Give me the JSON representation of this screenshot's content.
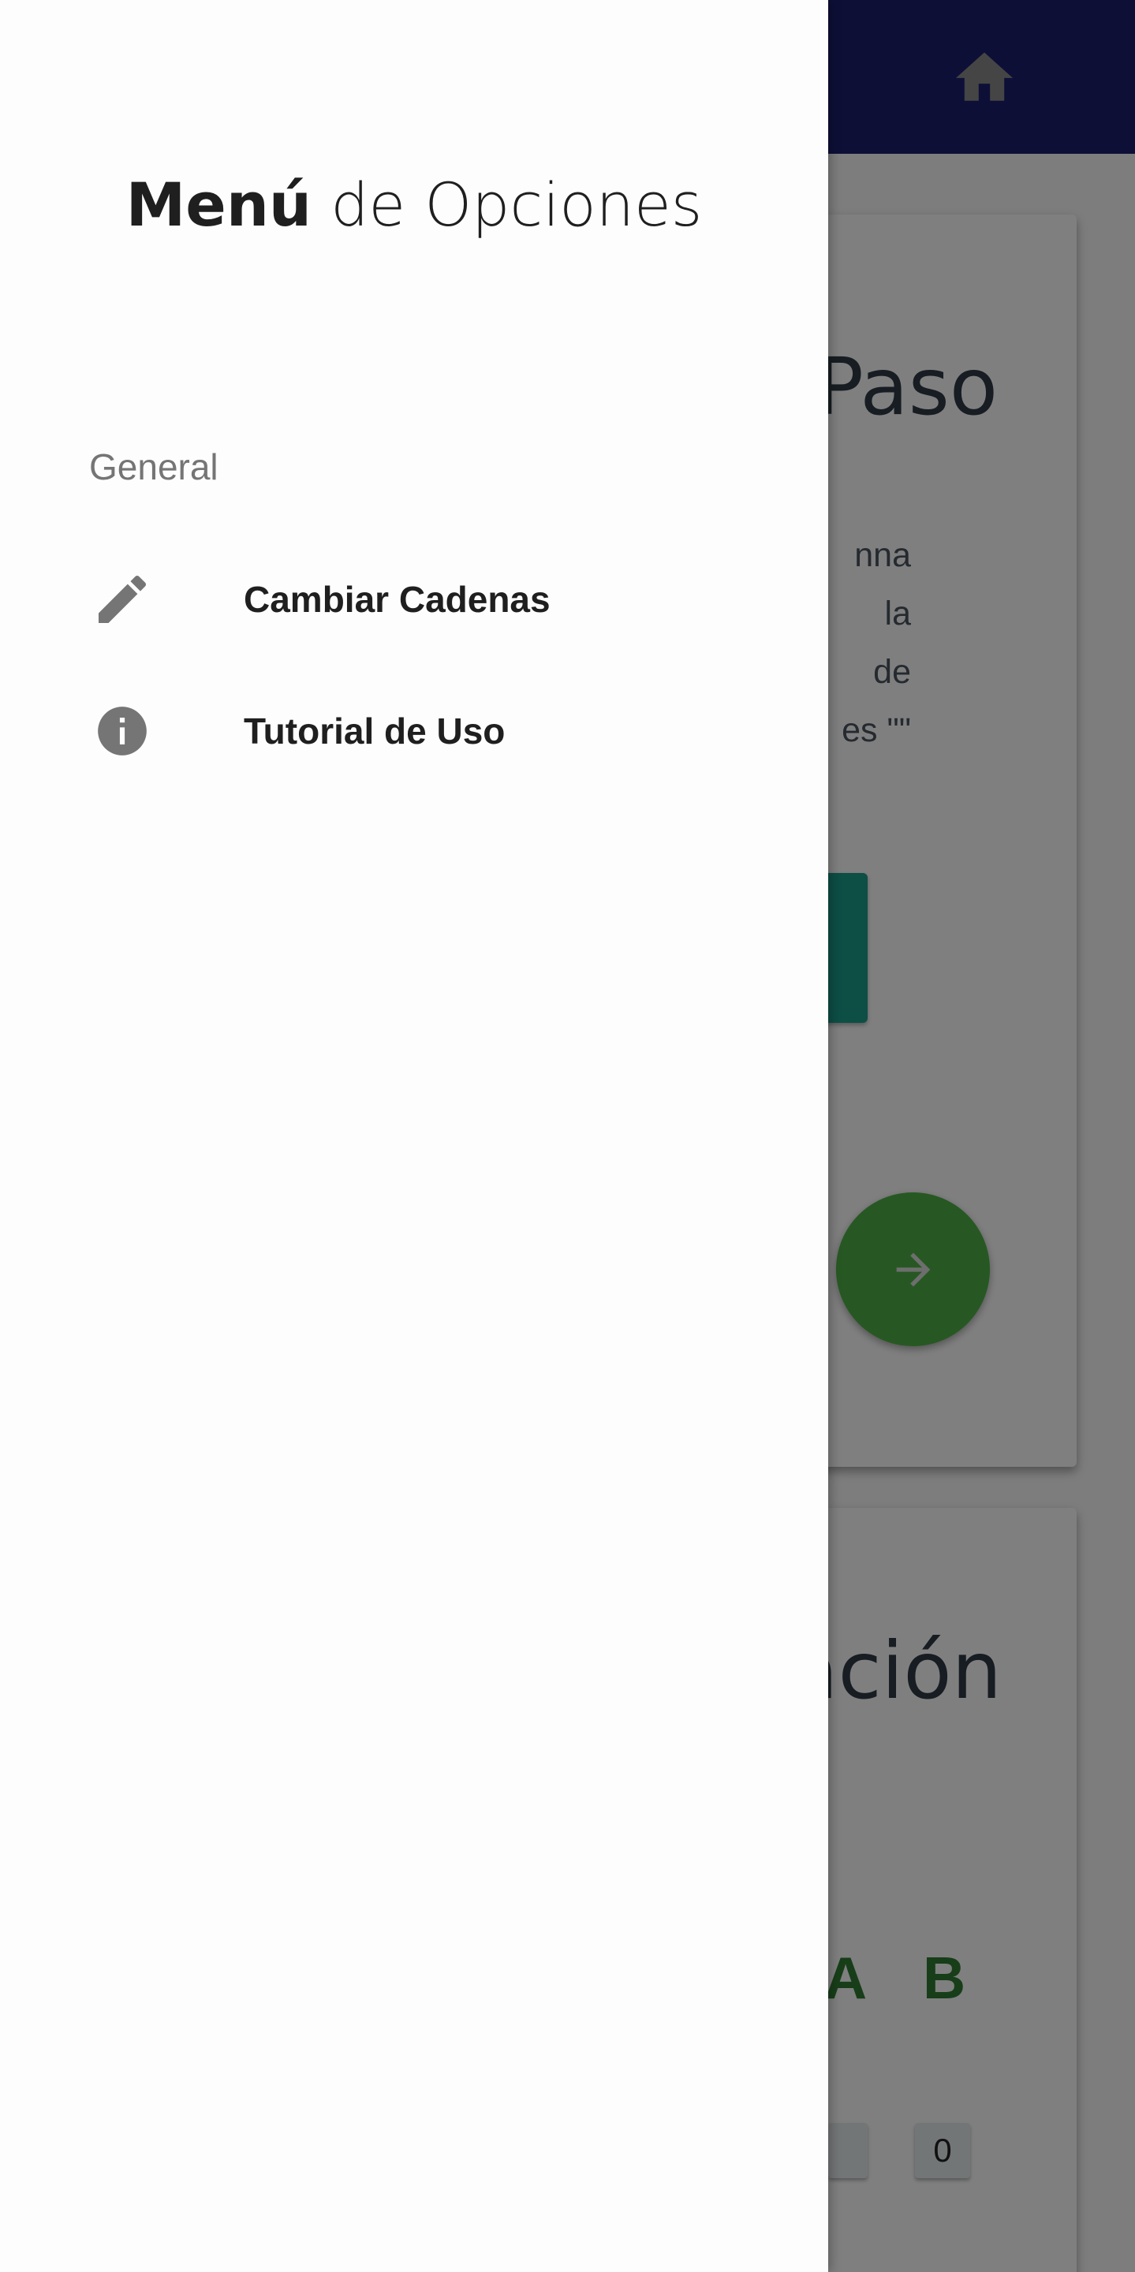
{
  "app": {
    "home_icon": "home-icon",
    "topbar_color": "#1a1f6f"
  },
  "background": {
    "card1": {
      "title": "Paso",
      "text_lines": [
        "nna",
        "la",
        "de",
        "es \"\""
      ],
      "fab_icon": "arrow-right-icon"
    },
    "card2": {
      "title": "ación",
      "column_a": "A",
      "column_b": "B",
      "cell_b_value": "0"
    }
  },
  "drawer": {
    "title_bold": "Menú",
    "title_rest": " de Opciones",
    "section_label": "General",
    "items": [
      {
        "label": "Cambiar Cadenas",
        "icon": "pencil-icon"
      },
      {
        "label": "Tutorial de Uso",
        "icon": "info-icon"
      }
    ]
  }
}
